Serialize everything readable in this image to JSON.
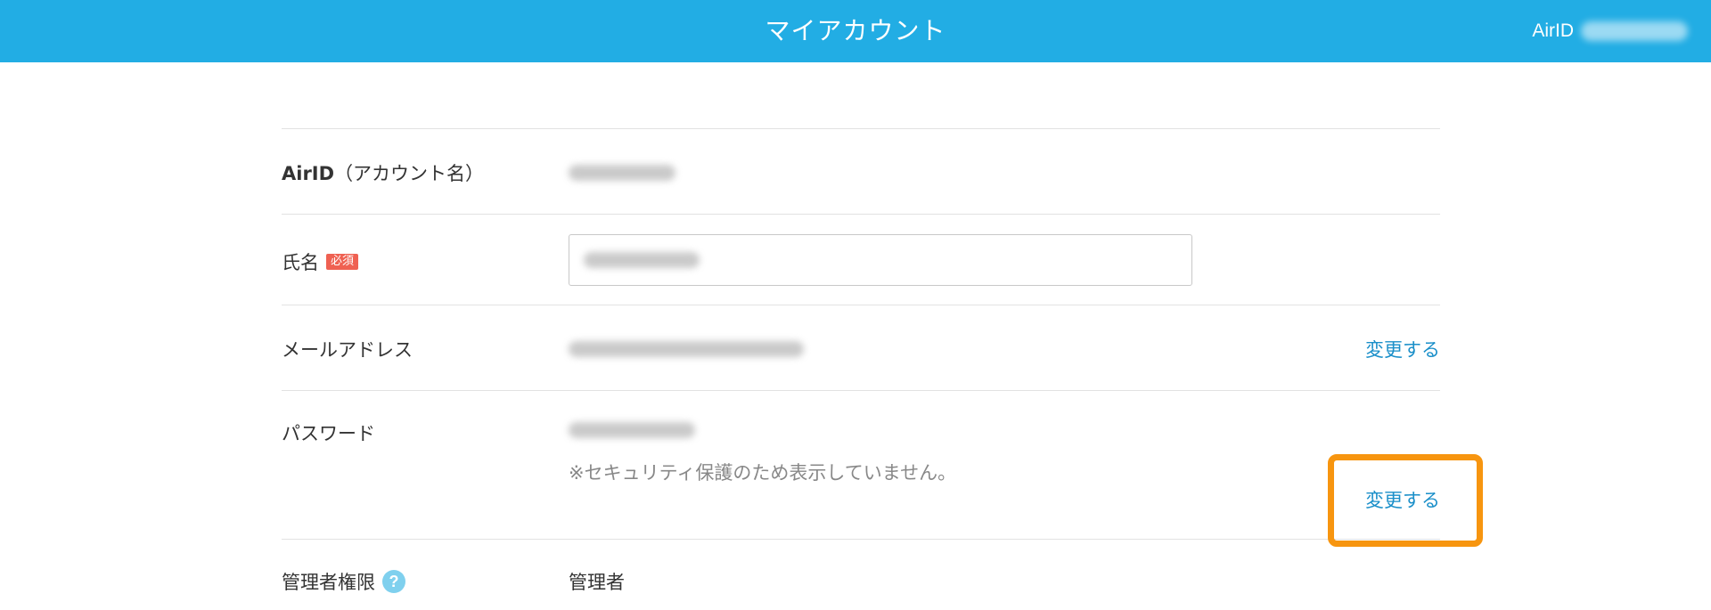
{
  "header": {
    "title": "マイアカウント",
    "user_label": "AirID"
  },
  "rows": {
    "airid": {
      "label_bold": "AirID",
      "label_rest": "（アカウント名）"
    },
    "name": {
      "label": "氏名",
      "badge": "必須"
    },
    "email": {
      "label": "メールアドレス",
      "change_label": "変更する"
    },
    "password": {
      "label": "パスワード",
      "note": "※セキュリティ保護のため表示していません。",
      "change_label": "変更する"
    },
    "admin": {
      "label": "管理者権限",
      "help_icon": "?",
      "value": "管理者"
    }
  },
  "colors": {
    "header_bg": "#22ade4",
    "link": "#1a8fc9",
    "highlight": "#f7950f",
    "badge_bg": "#ef6152"
  }
}
